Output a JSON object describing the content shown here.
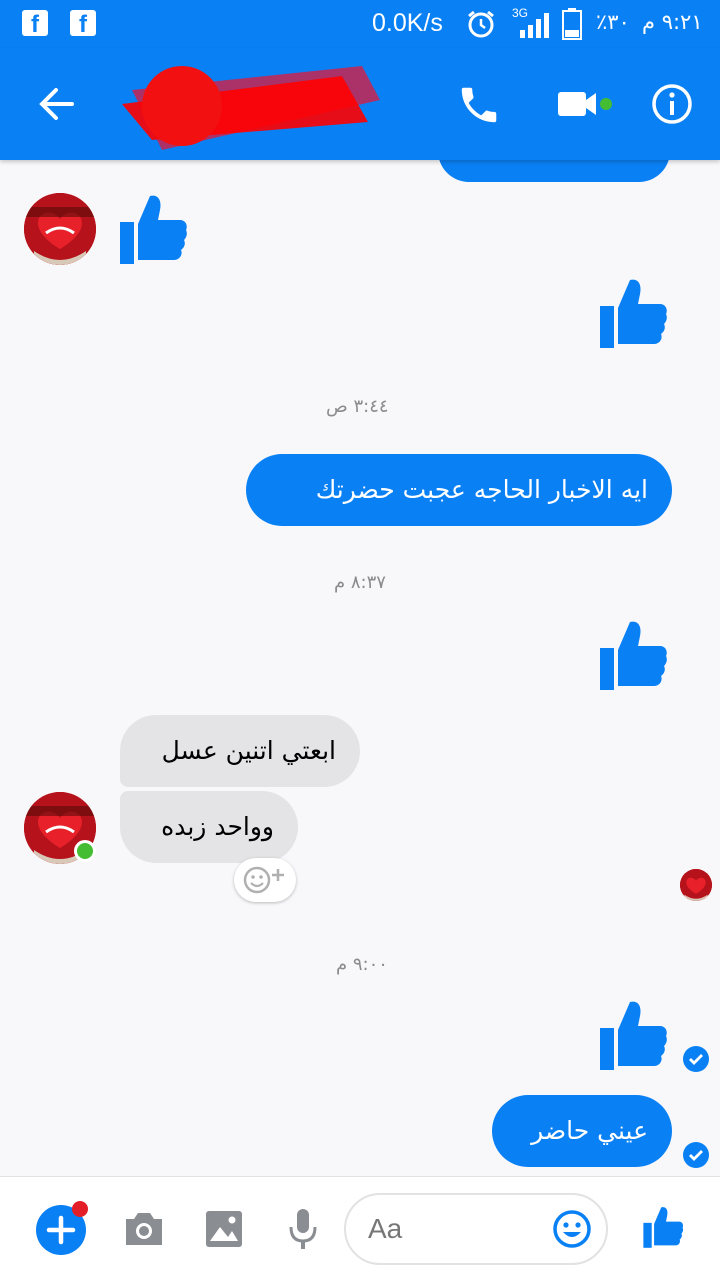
{
  "status_bar": {
    "net_speed": "0.0K/s",
    "network_type": "3G",
    "battery": "٪٣٠",
    "time": "٩:٢١ م",
    "icons": [
      "facebook-icon",
      "facebook-icon",
      "alarm-icon",
      "signal-icon",
      "battery-icon"
    ]
  },
  "header": {
    "icons": [
      "back-arrow-icon",
      "phone-icon",
      "video-icon",
      "info-icon"
    ],
    "active_indicator_color": "#44bd32"
  },
  "messages": {
    "ts1": "٣:٤٤ ص",
    "msg_out_1": "ايه الاخبار الحاجه عجبت حضرتك",
    "ts2": "٨:٣٧ م",
    "msg_in_1": "ابعتي اتنين عسل",
    "msg_in_2": "وواحد زبده",
    "ts3": "٩:٠٠ م",
    "msg_out_2": "عيني حاضر"
  },
  "composer": {
    "placeholder": "Aa",
    "icons": [
      "plus-icon",
      "camera-icon",
      "image-icon",
      "microphone-icon",
      "emoji-icon",
      "thumbs-up-icon"
    ]
  },
  "colors": {
    "brand_blue": "#0a80f5",
    "incoming_bubble": "#e4e4e6",
    "online_green": "#44bd32",
    "notification_red": "#e41e26"
  }
}
